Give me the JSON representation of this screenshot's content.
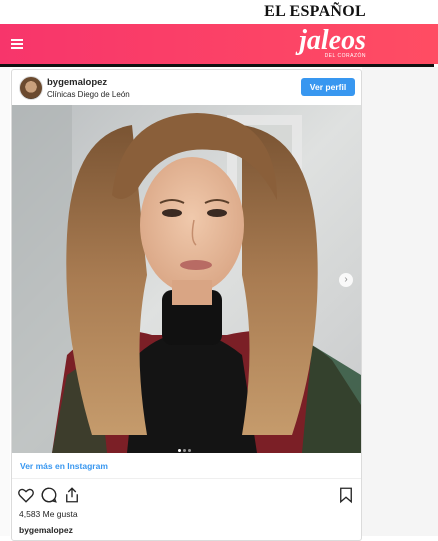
{
  "site": {
    "masthead": "EL ESPAÑOL",
    "brand": "jaleos",
    "brand_sub": "DEL CORAZÓN",
    "accent": "#f7356b",
    "menu_icon": "hamburger-icon"
  },
  "post": {
    "username": "bygemalopez",
    "location": "Clínicas Diego de León",
    "follow_button": "Ver perfil",
    "view_on_instagram": "Ver más en Instagram",
    "likes": "4,583 Me gusta",
    "caption_user": "bygemalopez",
    "carousel": {
      "total": 3,
      "current": 1
    },
    "icons": [
      "heart-icon",
      "comment-icon",
      "share-icon",
      "bookmark-icon",
      "chevron-right-icon"
    ]
  }
}
